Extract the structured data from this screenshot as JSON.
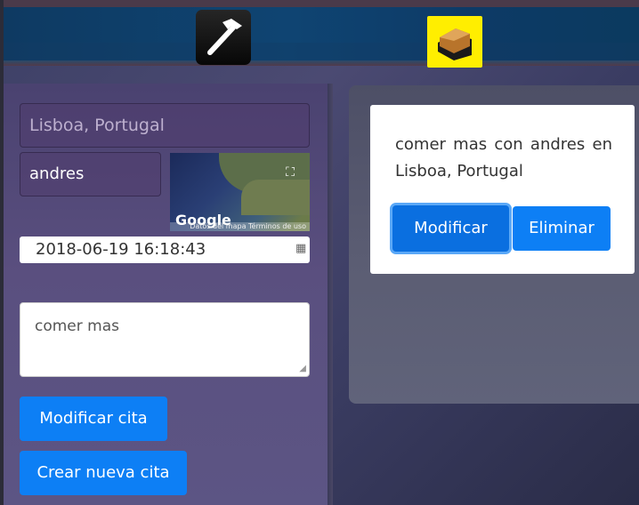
{
  "header": {
    "hammer_icon": "hammer-icon",
    "note_icon": "note-box-icon",
    "accent_color": "#ffee00"
  },
  "form": {
    "location_placeholder": "Lisboa, Portugal",
    "user_value": "andres",
    "map": {
      "google_logo": "Google",
      "attribution": "Datos del mapa",
      "terms": "Términos de uso"
    },
    "datetime_value": "2018-06-19 16:18:43",
    "note_value": "comer mas",
    "modify_button": "Modificar cita",
    "create_button": "Crear nueva cita"
  },
  "card": {
    "text": "comer mas con andres en Lisboa, Portugal",
    "modify_button": "Modificar",
    "delete_button": "Eliminar"
  },
  "colors": {
    "primary_button": "#0d7ff5",
    "header_bg": "#0f4472"
  }
}
